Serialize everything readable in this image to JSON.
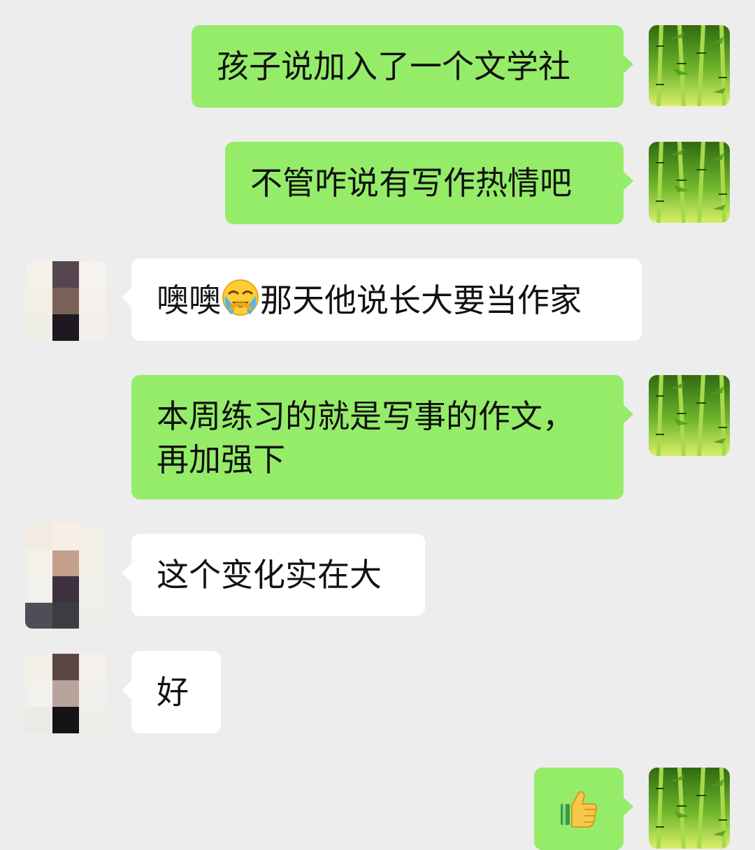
{
  "messages": [
    {
      "sender": "me",
      "text": "孩子说加入了一个文学社"
    },
    {
      "sender": "me",
      "text": "不管咋说有写作热情吧"
    },
    {
      "sender": "them",
      "before_emoji": "噢噢",
      "emoji": "loudly-crying-face-emoji",
      "after_emoji": "那天他说长大要当作家"
    },
    {
      "sender": "me",
      "line1": "本周练习的就是写事的作文，",
      "line2": "再加强下"
    },
    {
      "sender": "them",
      "text": "这个变化实在大"
    },
    {
      "sender": "them",
      "text": "好"
    },
    {
      "sender": "me",
      "emoji": "thumbs-up-emoji"
    }
  ],
  "colors": {
    "background": "#ededed",
    "my_bubble": "#95ec69",
    "their_bubble": "#ffffff"
  }
}
